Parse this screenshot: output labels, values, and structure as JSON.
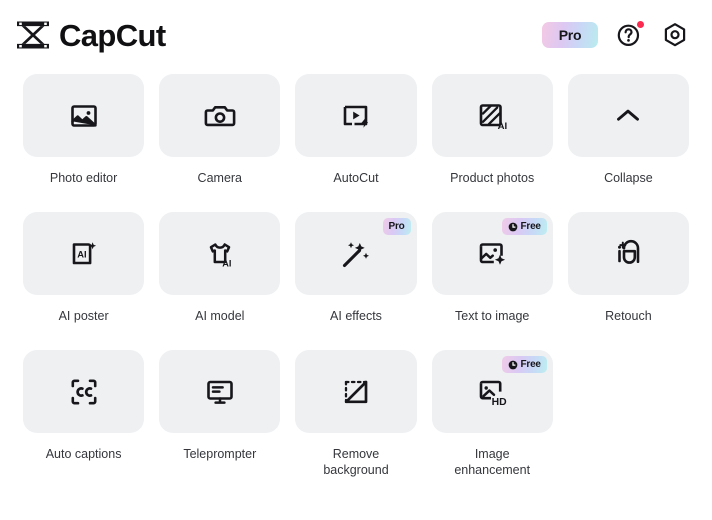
{
  "header": {
    "brand_name": "CapCut",
    "logo_icon": "capcut-logo-icon",
    "pro_label": "Pro",
    "help_icon": "question-circle-icon",
    "settings_icon": "gear-icon",
    "notification_dot": true
  },
  "grid": {
    "rows": [
      {
        "items": [
          {
            "label": "Photo editor",
            "icon": "image-edit-icon",
            "badge": null
          },
          {
            "label": "Camera",
            "icon": "camera-icon",
            "badge": null
          },
          {
            "label": "AutoCut",
            "icon": "video-bolt-icon",
            "badge": null
          },
          {
            "label": "Product photos",
            "icon": "ai-frame-icon",
            "badge": null
          },
          {
            "label": "Collapse",
            "icon": "chevron-up-icon",
            "badge": null
          }
        ]
      },
      {
        "items": [
          {
            "label": "AI poster",
            "icon": "ai-document-sparkle-icon",
            "badge": null
          },
          {
            "label": "AI model",
            "icon": "ai-tshirt-icon",
            "badge": null
          },
          {
            "label": "AI effects",
            "icon": "magic-wand-icon",
            "badge": {
              "text": "Pro",
              "type": "pro"
            }
          },
          {
            "label": "Text to image",
            "icon": "image-sparkle-icon",
            "badge": {
              "text": "Free",
              "type": "free"
            }
          },
          {
            "label": "Retouch",
            "icon": "retouch-face-icon",
            "badge": null
          }
        ]
      },
      {
        "items": [
          {
            "label": "Auto captions",
            "icon": "closed-caption-icon",
            "badge": null
          },
          {
            "label": "Teleprompter",
            "icon": "monitor-text-icon",
            "badge": null
          },
          {
            "label": "Remove\nbackground",
            "icon": "remove-background-icon",
            "badge": null
          },
          {
            "label": "Image\nenhancement",
            "icon": "image-hd-icon",
            "badge": {
              "text": "Free",
              "type": "free"
            }
          }
        ]
      }
    ]
  },
  "colors": {
    "page_background": "#ffffff",
    "tile_background": "#eef0f2",
    "icon": "#17171b",
    "label_text": "#35373c",
    "brand_text": "#101013",
    "notification_dot": "#fa2b4e",
    "badge_gradient_start": "#f0cbe8",
    "badge_gradient_end": "#bdeef0"
  }
}
